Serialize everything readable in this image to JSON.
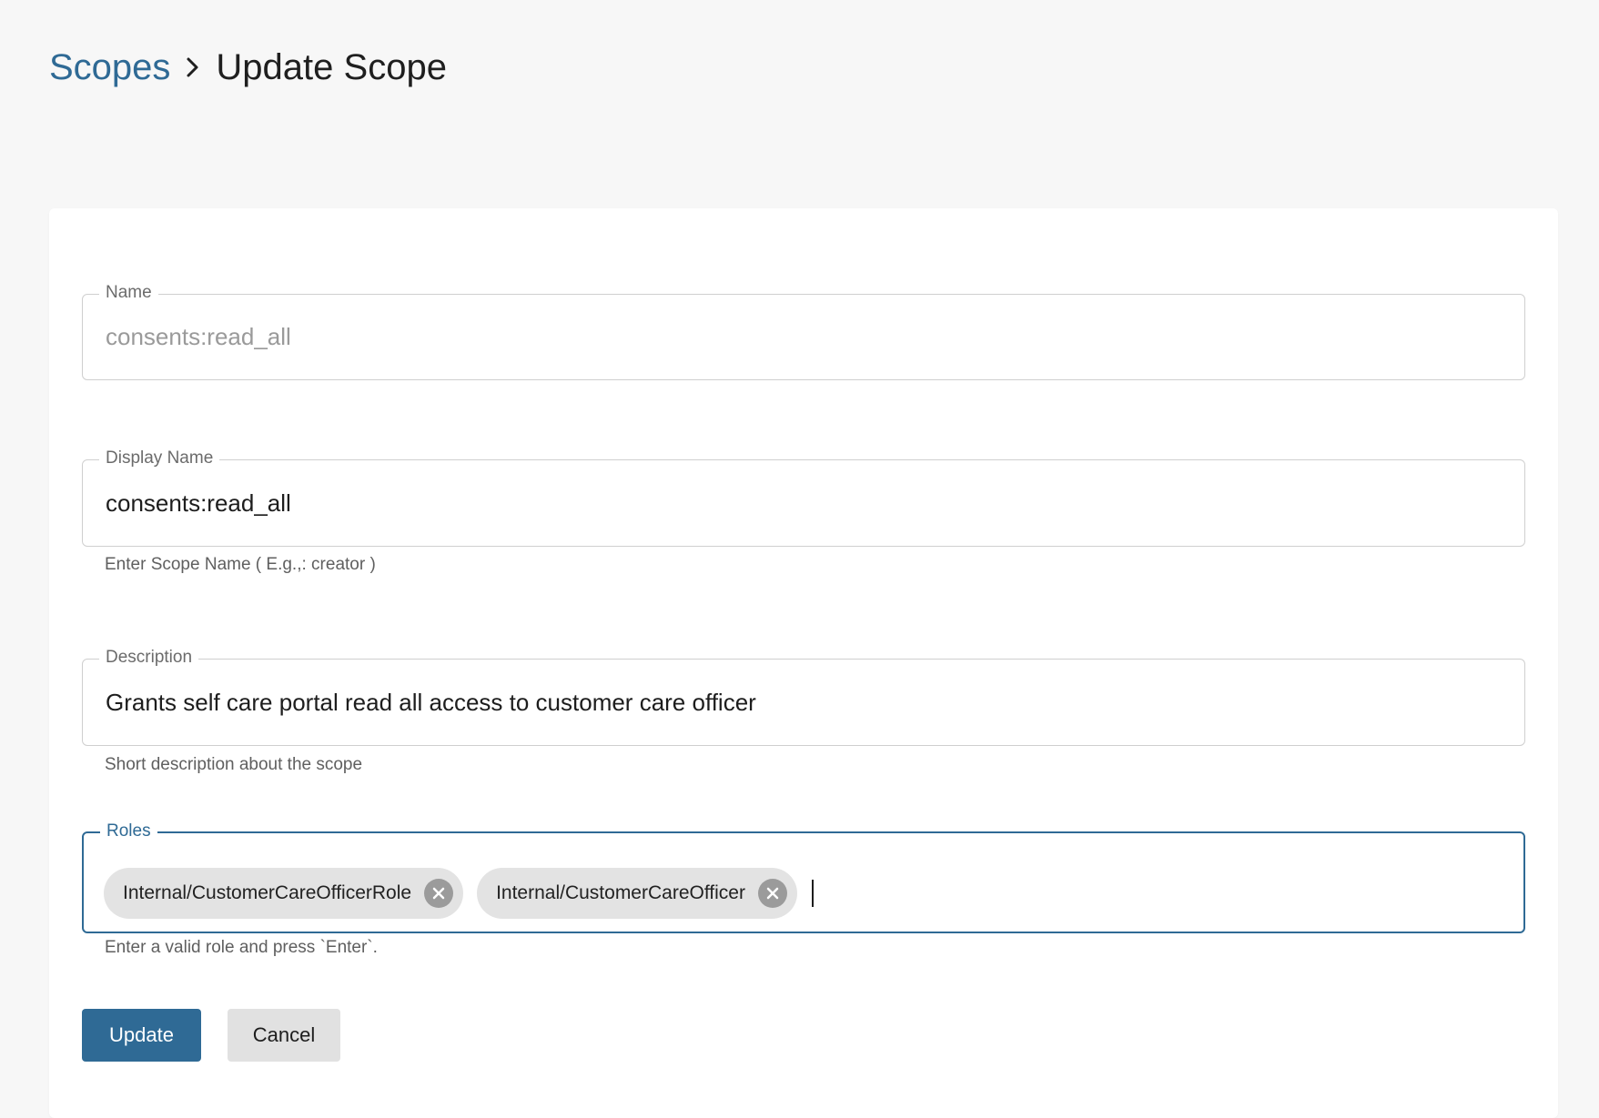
{
  "breadcrumb": {
    "parent": "Scopes",
    "current": "Update Scope"
  },
  "form": {
    "name": {
      "label": "Name",
      "value": "consents:read_all"
    },
    "display_name": {
      "label": "Display Name",
      "value": "consents:read_all",
      "helper": "Enter Scope Name ( E.g.,: creator )"
    },
    "description": {
      "label": "Description",
      "value": "Grants self care portal read all access to customer care officer",
      "helper": "Short description about the scope"
    },
    "roles": {
      "label": "Roles",
      "chips": [
        {
          "label": "Internal/CustomerCareOfficerRole"
        },
        {
          "label": "Internal/CustomerCareOfficer"
        }
      ],
      "helper": "Enter a valid role and press `Enter`."
    }
  },
  "actions": {
    "update_label": "Update",
    "cancel_label": "Cancel"
  },
  "colors": {
    "primary": "#2f6a95",
    "background": "#f7f7f7",
    "card": "#ffffff",
    "chip": "#e3e3e3"
  }
}
